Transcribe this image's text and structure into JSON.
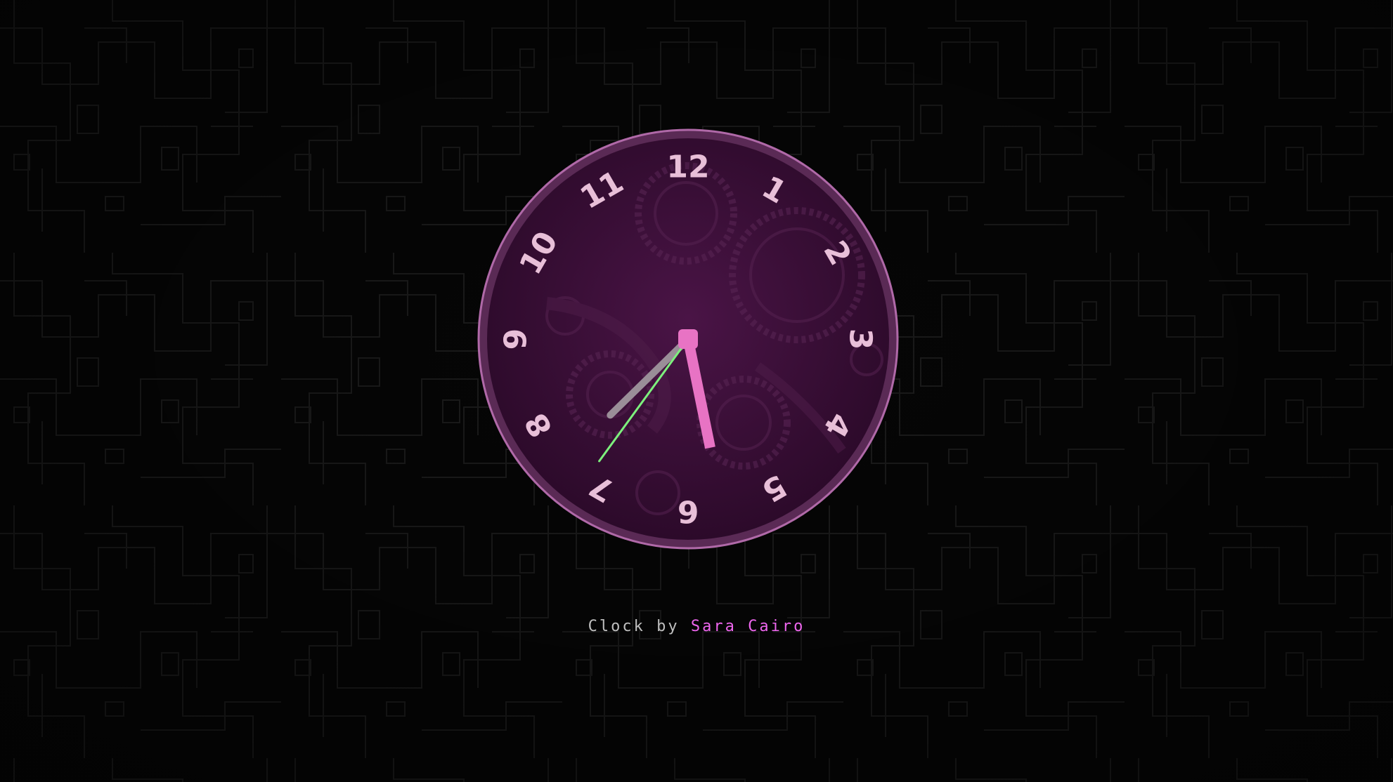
{
  "clock": {
    "numerals": [
      "12",
      "1",
      "2",
      "3",
      "4",
      "5",
      "6",
      "7",
      "8",
      "9",
      "10",
      "11"
    ],
    "time": {
      "hours": 5,
      "minutes": 37,
      "seconds": 36
    },
    "colors": {
      "face": "#3f0f3b",
      "rim": "#b069a8",
      "numeral": "#e8bfd8",
      "hour_hand": "#e873c4",
      "minute_hand": "#9a8e98",
      "second_hand": "#7df07d",
      "background": "#060606",
      "pattern": "#1c1c1c"
    }
  },
  "credit": {
    "prefix": "Clock by",
    "author": "Sara Cairo",
    "author_color": "#ee66ee"
  }
}
